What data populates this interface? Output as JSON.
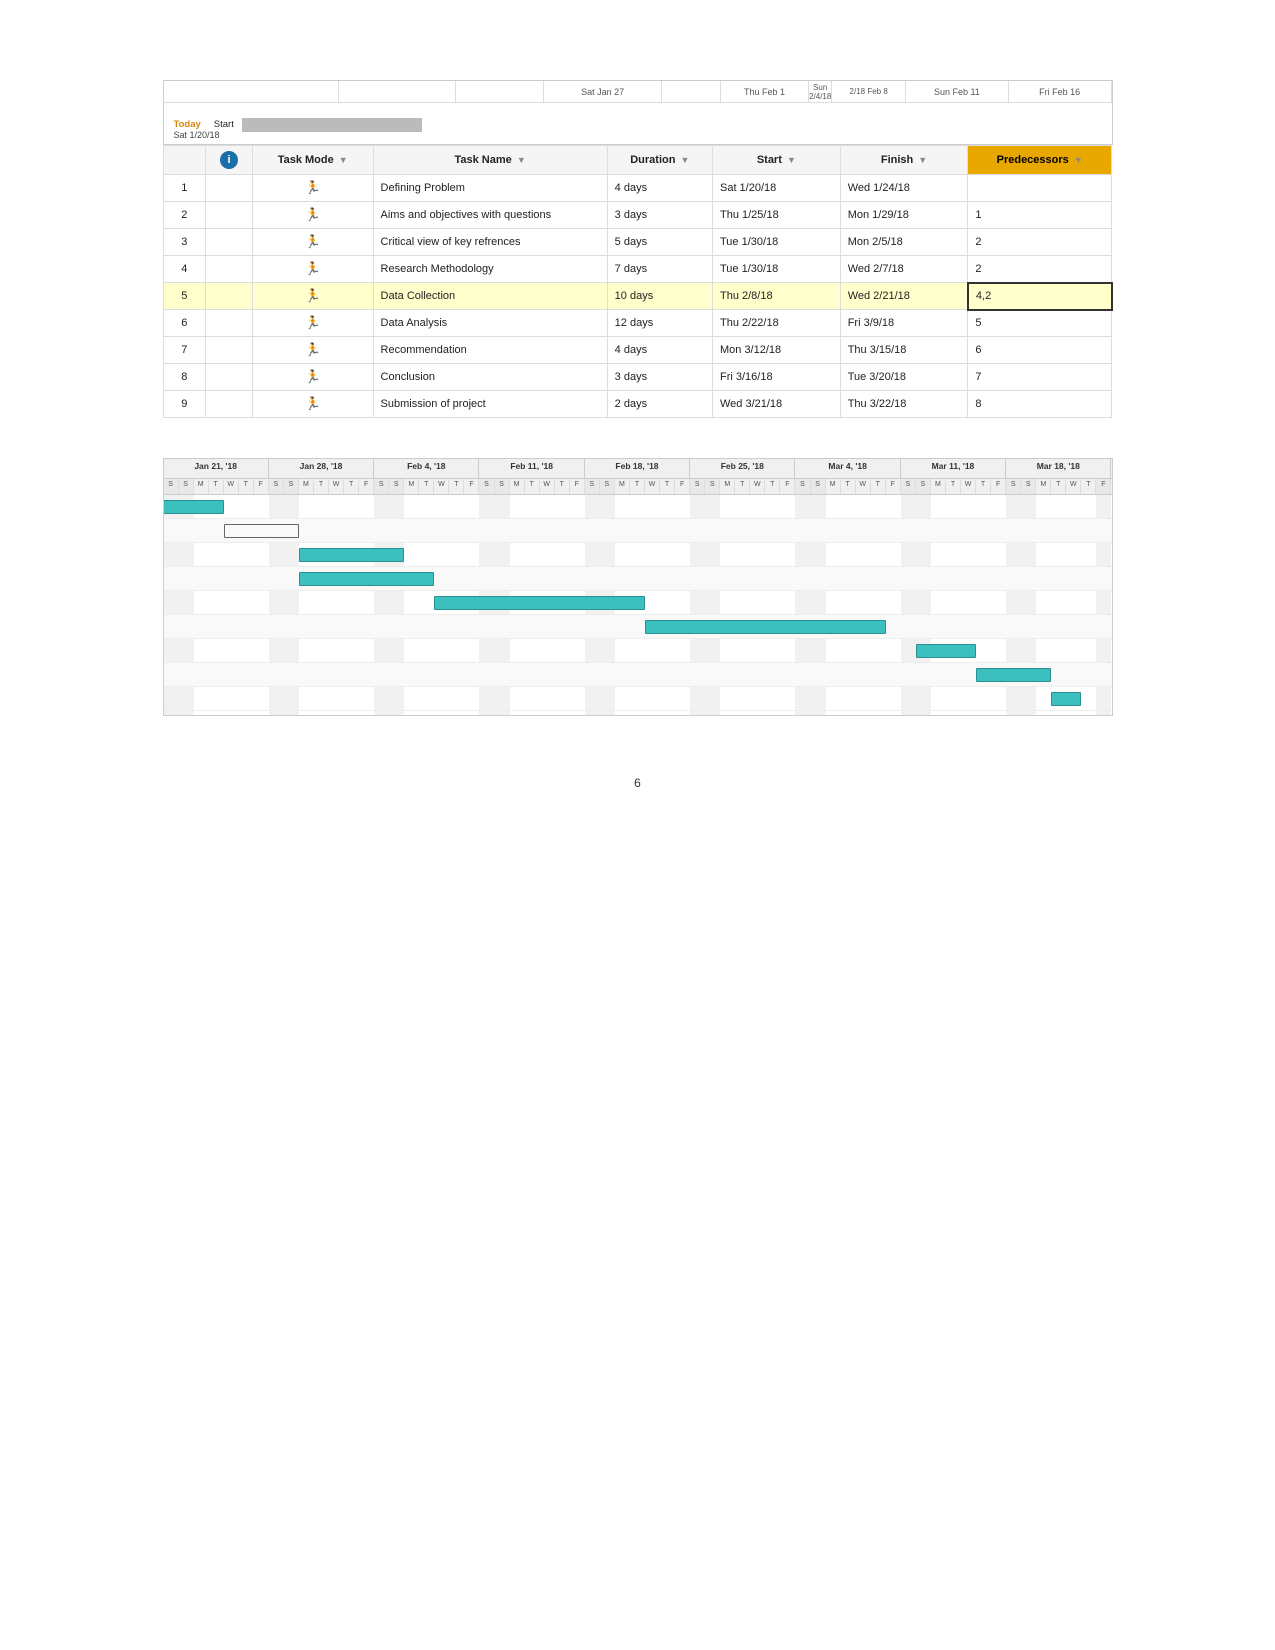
{
  "page": {
    "number": "6"
  },
  "timeline_header": {
    "today_label": "Today",
    "sat_jan": "Sat Jan 27",
    "thu_feb": "Thu Feb 1",
    "sun_feb_top": "Sun 2/4/18",
    "sun_feb_sub": "2/18 Feb 8",
    "sun_feb11": "Sun Feb 11",
    "fri_feb16": "Fri Feb 16",
    "start_label": "Start",
    "start_date": "Sat 1/20/18"
  },
  "table": {
    "headers": {
      "id": "",
      "info": "",
      "mode": "Task Mode",
      "name": "Task Name",
      "duration": "Duration",
      "start": "Start",
      "finish": "Finish",
      "predecessors": "Predecessors"
    },
    "rows": [
      {
        "id": 1,
        "mode": "🚀",
        "name": "Defining Problem",
        "duration": "4 days",
        "start": "Sat 1/20/18",
        "finish": "Wed 1/24/18",
        "predecessors": ""
      },
      {
        "id": 2,
        "mode": "🚀",
        "name": "Aims and objectives with questions",
        "duration": "3 days",
        "start": "Thu 1/25/18",
        "finish": "Mon 1/29/18",
        "predecessors": "1"
      },
      {
        "id": 3,
        "mode": "🚀",
        "name": "Critical view of key refrences",
        "duration": "5 days",
        "start": "Tue 1/30/18",
        "finish": "Mon 2/5/18",
        "predecessors": "2"
      },
      {
        "id": 4,
        "mode": "🚀",
        "name": "Research Methodology",
        "duration": "7 days",
        "start": "Tue 1/30/18",
        "finish": "Wed 2/7/18",
        "predecessors": "2"
      },
      {
        "id": 5,
        "mode": "🚀",
        "name": "Data Collection",
        "duration": "10 days",
        "start": "Thu 2/8/18",
        "finish": "Wed 2/21/18",
        "predecessors": "4,2",
        "highlighted": true
      },
      {
        "id": 6,
        "mode": "🚀",
        "name": "Data Analysis",
        "duration": "12 days",
        "start": "Thu 2/22/18",
        "finish": "Fri 3/9/18",
        "predecessors": "5"
      },
      {
        "id": 7,
        "mode": "🚀",
        "name": "Recommendation",
        "duration": "4 days",
        "start": "Mon 3/12/18",
        "finish": "Thu 3/15/18",
        "predecessors": "6"
      },
      {
        "id": 8,
        "mode": "🚀",
        "name": "Conclusion",
        "duration": "3 days",
        "start": "Fri 3/16/18",
        "finish": "Tue 3/20/18",
        "predecessors": "7"
      },
      {
        "id": 9,
        "mode": "🚀",
        "name": "Submission of project",
        "duration": "2 days",
        "start": "Wed 3/21/18",
        "finish": "Thu 3/22/18",
        "predecessors": "8"
      }
    ]
  },
  "gantt": {
    "weeks": [
      "Jan 21, '18",
      "Jan 28, '18",
      "Feb 4, '18",
      "Feb 11, '18",
      "Feb 18, '18",
      "Feb 25, '18",
      "Mar 4, '18",
      "Mar 11, '18",
      "Mar 18, '18"
    ],
    "days_per_week": [
      "S",
      "S",
      "M",
      "T",
      "W",
      "T",
      "F",
      "S",
      "M",
      "T",
      "W",
      "T",
      "F",
      "S",
      "M",
      "T",
      "W",
      "T",
      "F",
      "S",
      "M",
      "T",
      "W",
      "T",
      "F",
      "S",
      "M",
      "T",
      "W",
      "T",
      "F",
      "S",
      "M",
      "T",
      "W",
      "T",
      "F",
      "S",
      "M",
      "T",
      "W",
      "T",
      "F",
      "S",
      "M",
      "T",
      "W",
      "T",
      "F",
      "S",
      "M",
      "T",
      "W",
      "T",
      "F",
      "S",
      "M",
      "T",
      "W",
      "T",
      "F",
      "S",
      "M"
    ]
  }
}
